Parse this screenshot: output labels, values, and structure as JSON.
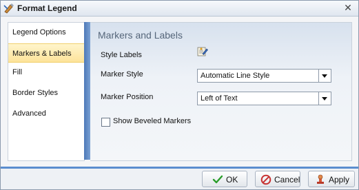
{
  "window": {
    "title": "Format Legend",
    "icon": "format-legend-icon",
    "close_icon": "close-icon"
  },
  "nav": {
    "items": [
      {
        "label": "Legend Options",
        "selected": false
      },
      {
        "label": "Markers & Labels",
        "selected": true
      },
      {
        "label": "Fill",
        "selected": false
      },
      {
        "label": "Border Styles",
        "selected": false
      },
      {
        "label": "Advanced",
        "selected": false
      }
    ]
  },
  "panel": {
    "title": "Markers and Labels",
    "style_labels": {
      "label": "Style Labels",
      "icon": "edit-style-icon"
    },
    "marker_style": {
      "label": "Marker Style",
      "value": "Automatic Line Style"
    },
    "marker_position": {
      "label": "Marker Position",
      "value": "Left of Text"
    },
    "beveled": {
      "label": "Show Beveled Markers",
      "checked": false
    }
  },
  "footer": {
    "ok": {
      "label": "OK",
      "icon": "checkmark-icon"
    },
    "cancel": {
      "label": "Cancel",
      "icon": "cancel-icon"
    },
    "apply": {
      "label": "Apply",
      "icon": "apply-stamp-icon"
    }
  },
  "colors": {
    "accent": "#5b8dcf",
    "selected_nav": "#fde39a"
  }
}
